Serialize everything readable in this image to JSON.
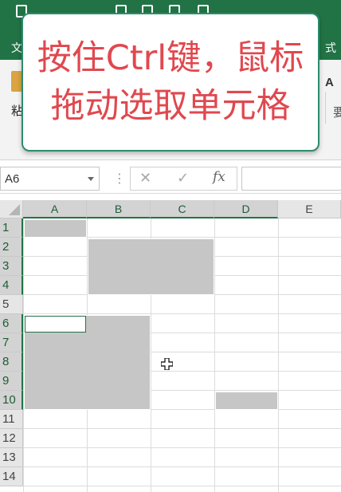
{
  "ribbon": {
    "tab_left": "文",
    "tab_right": "式",
    "paste_label": "粘",
    "font_letter": "A",
    "right_char": "要"
  },
  "callout": {
    "line1": "按住Ctrl键，鼠标",
    "line2": "拖动选取单元格"
  },
  "formula_bar": {
    "name_box": "A6",
    "cancel_glyph": "✕",
    "enter_glyph": "✓",
    "fx_label": "fx",
    "dots": "⋮"
  },
  "grid": {
    "columns": [
      "A",
      "B",
      "C",
      "D",
      "E"
    ],
    "rows": [
      "1",
      "2",
      "3",
      "4",
      "5",
      "6",
      "7",
      "8",
      "9",
      "10",
      "11",
      "12",
      "13",
      "14"
    ],
    "active_cell": "A6",
    "selected_ranges": [
      "A1",
      "B2:C4",
      "A6:B10",
      "D10"
    ]
  },
  "icons": {
    "cursor": "cross-cursor-icon"
  },
  "colors": {
    "ribbon_green": "#217346",
    "callout_text": "#e0484e",
    "callout_border": "#2e8b6f",
    "selection_fill": "#c6c6c6"
  }
}
